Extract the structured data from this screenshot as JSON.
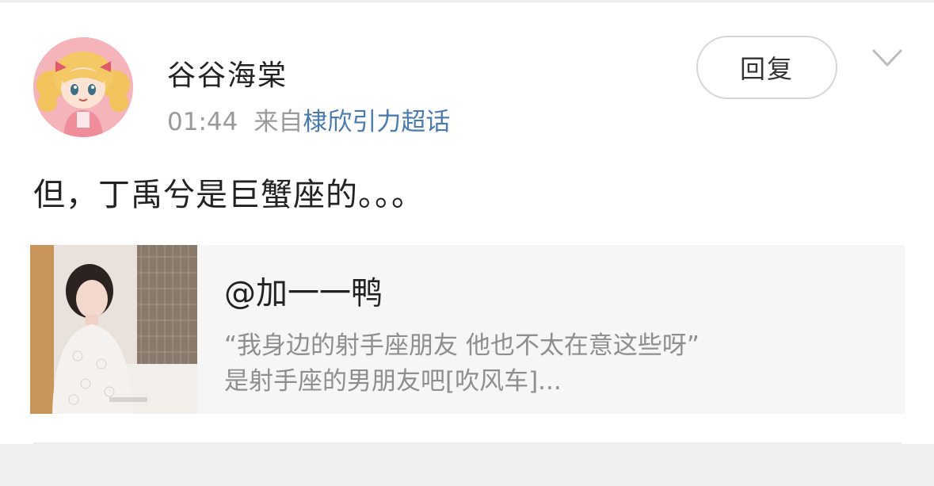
{
  "post": {
    "username": "谷谷海棠",
    "time": "01:44",
    "source_prefix": "来自",
    "source_link": "棣欣引力超话",
    "reply_label": "回复",
    "content": "但，丁禹兮是巨蟹座的。。。"
  },
  "quote": {
    "author": "@加一一鸭",
    "line1": "“我身边的射手座朋友 他也不太在意这些呀”",
    "line2": "是射手座的男朋友吧[吹风车]..."
  },
  "icons": {
    "avatar": "anime-girl-avatar",
    "more": "chevron-down-icon"
  },
  "colors": {
    "link": "#4a7ab0",
    "card_bg": "#f6f6f6"
  }
}
